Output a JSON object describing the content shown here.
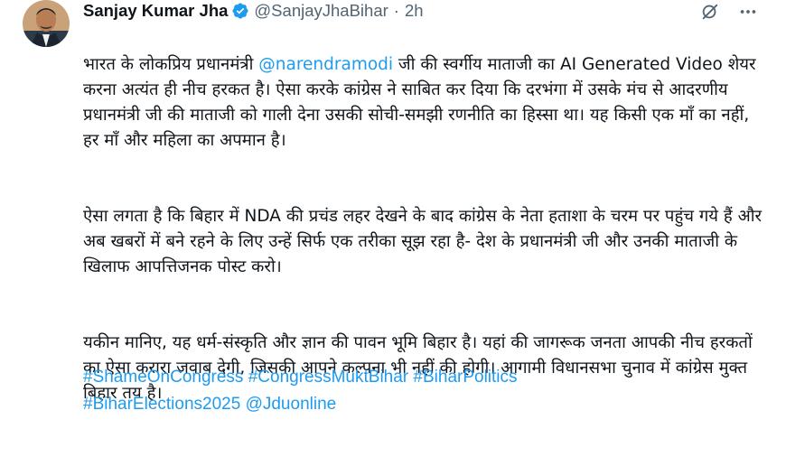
{
  "tweet": {
    "author": {
      "name": "Sanjay Kumar Jha",
      "handle": "@SanjayJhaBihar",
      "separator": "·",
      "time": "2h"
    },
    "icons": {
      "verified": "verified-badge-icon",
      "grok": "grok-icon",
      "more": "more-icon"
    },
    "text": {
      "p1_a": "भारत के लोकप्रिय प्रधानमंत्री ",
      "p1_mention": "@narendramodi",
      "p1_b": " जी की स्वर्गीय माताजी का AI Generated Video शेयर करना अत्यंत ही नीच हरकत है। ऐसा करके कांग्रेस ने साबित कर दिया कि दरभंगा में उसके मंच से आदरणीय प्रधानमंत्री जी की माताजी को गाली देना उसकी सोची-समझी रणनीति का हिस्सा था। यह किसी एक माँ का नहीं, हर माँ और महिला का अपमान है।",
      "p2": "ऐसा लगता है कि बिहार में NDA की प्रचंड लहर देखने के बाद कांग्रेस के नेता हताशा के चरम पर पहुंच गये हैं और अब खबरों में बने रहने के लिए उन्हें सिर्फ एक तरीका सूझ रहा है- देश के प्रधानमंत्री जी और उनकी माताजी के खिलाफ आपत्तिजनक पोस्ट करो।",
      "p3": "यकीन मानिए, यह धर्म-संस्कृति और ज्ञान की पावन भूमि बिहार है। यहां की जागरूक जनता आपकी नीच हरकतों का ऐसा करारा जवाब देगी, जिसकी आपने कल्पना भी नहीं की होगी। आगामी विधानसभा चुनाव में कांग्रेस मुक्त बिहार तय है।"
    },
    "hashtags": {
      "h1": "#ShameOnCongress",
      "h2": "#CongressMuktBihar",
      "h3": "#BiharPolitics",
      "h4": "#BiharElections2025",
      "mention": "@Jduonline"
    },
    "colors": {
      "link": "#1d9bf0",
      "text": "#0f1419",
      "secondary": "#536471"
    }
  }
}
